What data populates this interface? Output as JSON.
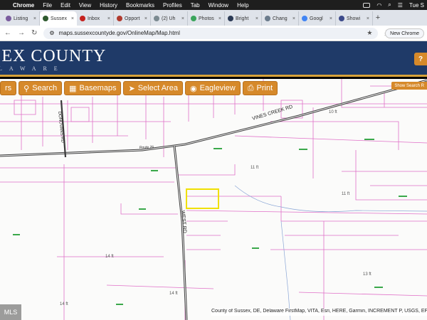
{
  "menubar": {
    "app_name": "Chrome",
    "items": [
      "File",
      "Edit",
      "View",
      "History",
      "Bookmarks",
      "Profiles",
      "Tab",
      "Window",
      "Help"
    ],
    "clock": "Tue S"
  },
  "tabs": [
    {
      "label": "Listing",
      "color": "#7a5c9e"
    },
    {
      "label": "Sussex",
      "color": "#2f5a2f",
      "active": true
    },
    {
      "label": "Inbox",
      "color": "#c5221f"
    },
    {
      "label": "Opport",
      "color": "#b03a2e"
    },
    {
      "label": "(2) Uh",
      "color": "#7b8a91"
    },
    {
      "label": "Photos",
      "color": "#3ba55c"
    },
    {
      "label": "Bright",
      "color": "#2b3a55"
    },
    {
      "label": "Chang",
      "color": "#6b7b8c"
    },
    {
      "label": "Googl",
      "color": "#4285f4"
    },
    {
      "label": "Showi",
      "color": "#3c4a8a"
    }
  ],
  "address": {
    "url": "maps.sussexcountyde.gov/OnlineMap/Map.html",
    "new_chrome_label": "New Chrome"
  },
  "header": {
    "title": "SEX COUNTY",
    "subtitle": "LAWARE"
  },
  "toolbar": {
    "buttons": [
      {
        "label": "rs",
        "glyph": ""
      },
      {
        "label": "Search",
        "glyph": "⚲"
      },
      {
        "label": "Basemaps",
        "glyph": "▦"
      },
      {
        "label": "Select Area",
        "glyph": "➤"
      },
      {
        "label": "Eagleview",
        "glyph": "◉"
      },
      {
        "label": "Print",
        "glyph": "⎙"
      }
    ],
    "show_search": "Show Search R"
  },
  "map": {
    "road_labels": [
      "VINES CREEK RD",
      "DONOVANS RD",
      "WEST RD",
      "Route 26"
    ],
    "contours": [
      "11 ft",
      "11 ft",
      "13 ft",
      "14 ft",
      "14 ft",
      "14 ft",
      "10 ft"
    ],
    "attribution": "County of Sussex, DE, Delaware FirstMap, VITA, Esri, HERE, Garmin, INCREMENT P, USGS, EPA, USDA | E..."
  },
  "mls_badge": "MLS",
  "colors": {
    "header_bg": "#1f3a68",
    "accent": "#d6892a",
    "parcel_line": "#e070c8",
    "selection": "#f0e000"
  }
}
